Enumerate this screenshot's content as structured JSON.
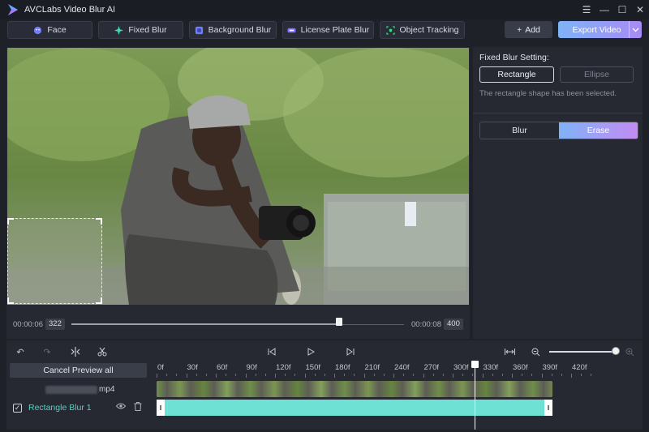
{
  "app": {
    "title": "AVCLabs Video Blur AI"
  },
  "window_controls": {
    "menu": "☰",
    "minimize": "—",
    "maximize": "☐",
    "close": "✕"
  },
  "toolbar": {
    "modes": [
      {
        "label": "Face",
        "icon": "face-icon"
      },
      {
        "label": "Fixed Blur",
        "icon": "fixed-blur-icon"
      },
      {
        "label": "Background Blur",
        "icon": "background-blur-icon"
      },
      {
        "label": "License Plate Blur",
        "icon": "license-plate-icon"
      },
      {
        "label": "Object Tracking",
        "icon": "object-tracking-icon"
      }
    ],
    "add_label": "Add",
    "add_icon": "+",
    "export_label": "Export Video"
  },
  "preview": {
    "current_time": "00:00:06",
    "current_frame": "322",
    "end_time": "00:00:08",
    "end_frame": "400"
  },
  "settings": {
    "title": "Fixed Blur Setting:",
    "shape_options": [
      "Rectangle",
      "Ellipse"
    ],
    "selected_shape": "Rectangle",
    "note": "The rectangle shape has been selected.",
    "mode_options": [
      "Blur",
      "Erase"
    ],
    "selected_mode": "Erase",
    "accent": "#7fb3f7"
  },
  "timeline": {
    "cancel_preview_label": "Cancel Preview all",
    "file_name_suffix": "mp4",
    "track_name": "Rectangle Blur 1",
    "ruler_labels": [
      "0f",
      "30f",
      "60f",
      "90f",
      "120f",
      "150f",
      "180f",
      "210f",
      "240f",
      "270f",
      "300f",
      "330f",
      "360f",
      "390f",
      "420f"
    ],
    "track_color": "#6fe1d4"
  }
}
